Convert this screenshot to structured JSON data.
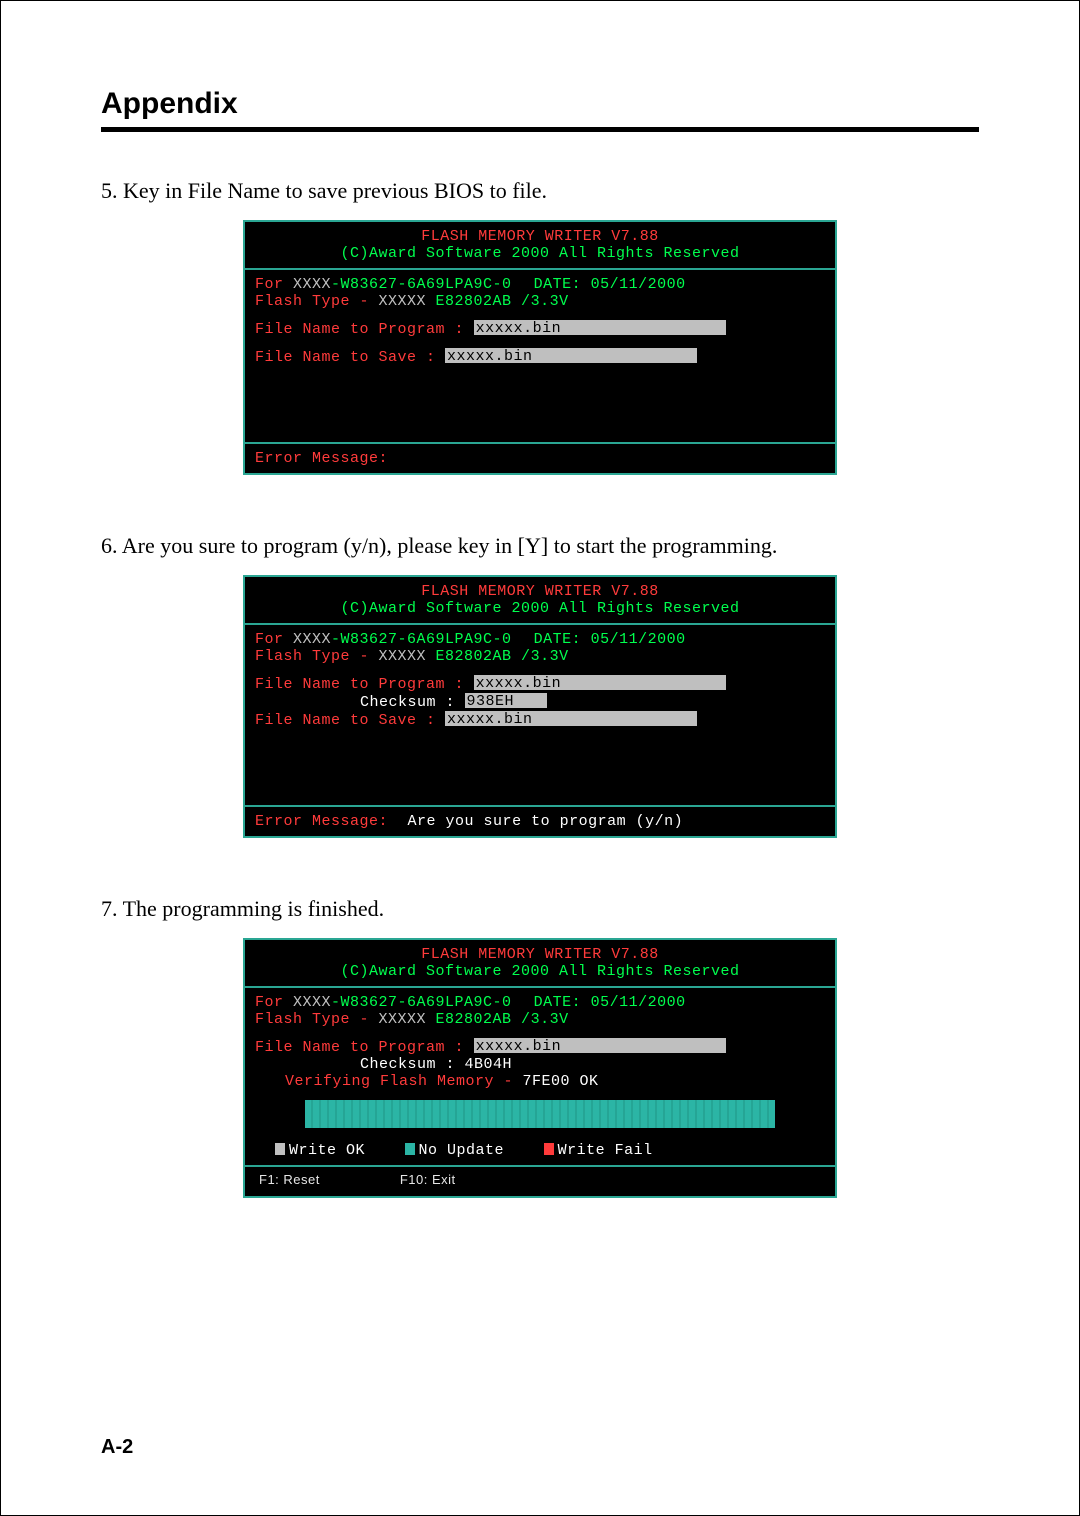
{
  "title": "Appendix",
  "page_number": "A-2",
  "bios_common": {
    "header_title": "FLASH  MEMORY  WRITER V7.88",
    "copyright": "(C)Award Software 2000 All Rights Reserved",
    "for_prefix": "For ",
    "for_xxxx": "XXXX",
    "for_code": "-W83627-6A69LPA9C-0",
    "date_label": "DATE: 05/11/2000",
    "flash_label": "Flash Type - ",
    "flash_xxxx": "XXXXX",
    "flash_rest": " E82802AB /3.3V",
    "fname_prog": "File Name to Program :",
    "fname_save": "File Name to Save    :",
    "checksum_label": "Checksum :",
    "xxxxx_bin": "xxxxx.bin",
    "error_label": "Error Message:"
  },
  "steps": {
    "s5": {
      "text": "5. Key in File Name to save previous BIOS to file."
    },
    "s6": {
      "text": "6. Are you sure to program (y/n), please key in [Y] to start the programming.",
      "checksum": "938EH",
      "prompt": "Are you sure to program (y/n)"
    },
    "s7": {
      "text": "7. The programming is finished.",
      "checksum": "4B04H",
      "verify": "Verifying Flash Memory - ",
      "verify_addr": "7FE00 OK",
      "legend_ok": "Write OK",
      "legend_noupd": "No Update",
      "legend_fail": "Write Fail",
      "f1": "F1: Reset",
      "f10": "F10: Exit"
    }
  }
}
